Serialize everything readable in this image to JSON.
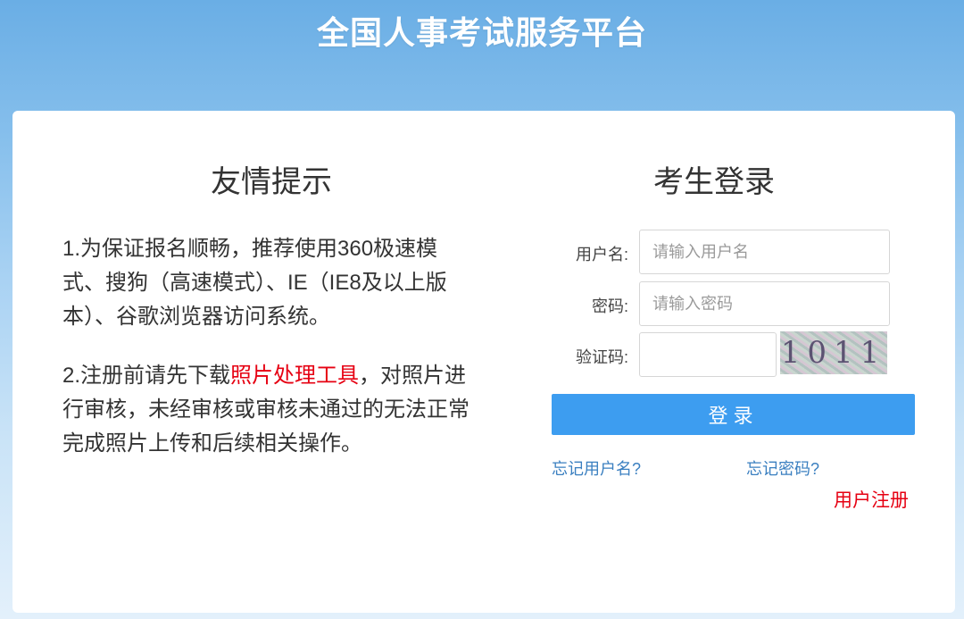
{
  "header": {
    "title": "全国人事考试服务平台"
  },
  "tips": {
    "title": "友情提示",
    "item1": "1.为保证报名顺畅，推荐使用360极速模式、搜狗（高速模式）、IE（IE8及以上版本）、谷歌浏览器访问系统。",
    "item2_before": "2.注册前请先下载",
    "item2_link": "照片处理工具",
    "item2_after": "，对照片进行审核，未经审核或审核未通过的无法正常完成照片上传和后续相关操作。"
  },
  "login": {
    "title": "考生登录",
    "username_label": "用户名:",
    "username_placeholder": "请输入用户名",
    "password_label": "密码:",
    "password_placeholder": "请输入密码",
    "captcha_label": "验证码:",
    "captcha_value": "",
    "captcha_text": "1011",
    "submit_label": "登录",
    "forgot_username": "忘记用户名?",
    "forgot_password": "忘记密码?",
    "register": "用户注册"
  },
  "colors": {
    "accent_blue": "#3d9df0",
    "link_blue": "#3a7fc0",
    "highlight_red": "#e60012"
  }
}
